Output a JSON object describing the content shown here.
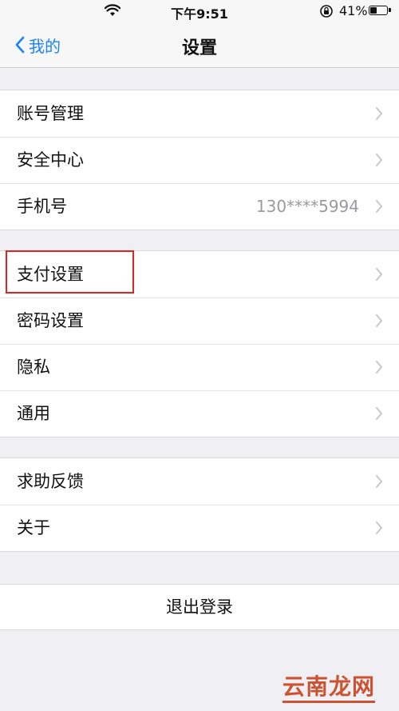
{
  "status_bar": {
    "time": "下午9:51",
    "battery": "41%",
    "battery_level": 0.41
  },
  "nav": {
    "back_label": "我的",
    "title": "设置"
  },
  "groups": [
    {
      "items": [
        {
          "label": "账号管理"
        },
        {
          "label": "安全中心"
        },
        {
          "label": "手机号",
          "value": "130****5994"
        }
      ]
    },
    {
      "items": [
        {
          "label": "支付设置",
          "highlighted": true
        },
        {
          "label": "密码设置"
        },
        {
          "label": "隐私"
        },
        {
          "label": "通用"
        }
      ]
    },
    {
      "items": [
        {
          "label": "求助反馈"
        },
        {
          "label": "关于"
        }
      ]
    }
  ],
  "logout_label": "退出登录",
  "watermark": "云南龙网",
  "colors": {
    "accent": "#1a82fb",
    "highlight": "#e02424",
    "background": "#efeff4"
  }
}
